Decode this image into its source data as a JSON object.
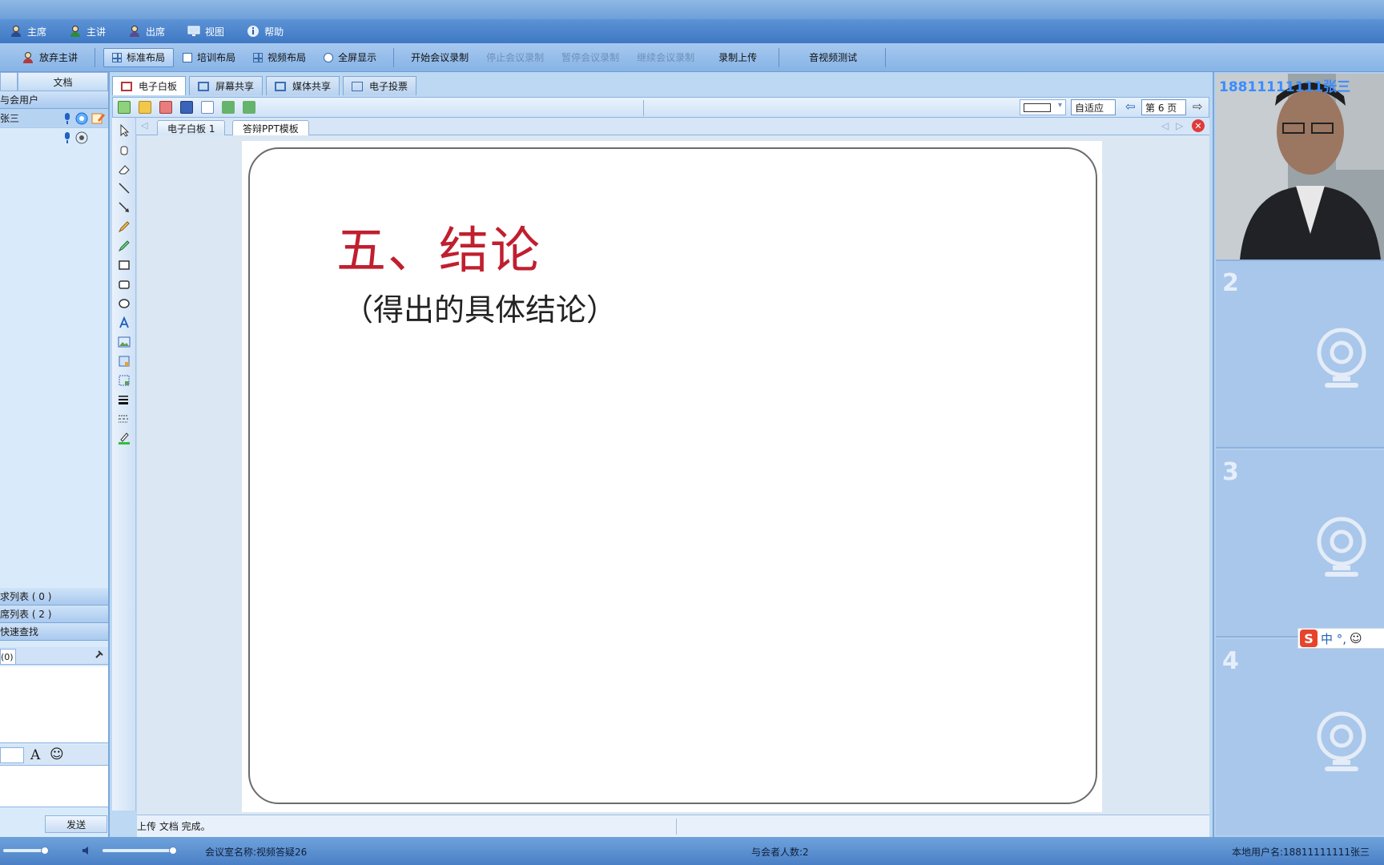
{
  "menubar": {
    "items": [
      {
        "label": "主席"
      },
      {
        "label": "主讲"
      },
      {
        "label": "出席"
      },
      {
        "label": "视图"
      },
      {
        "label": "帮助"
      }
    ]
  },
  "toolbar": {
    "give_up": "放弃主讲",
    "standard_layout": "标准布局",
    "training_layout": "培训布局",
    "video_layout": "视频布局",
    "fullscreen": "全屏显示",
    "start_record": "开始会议录制",
    "stop_record": "停止会议录制",
    "pause_record": "暂停会议录制",
    "resume_record": "继续会议录制",
    "upload_record": "录制上传",
    "av_test": "音视频测试"
  },
  "left_panel": {
    "tab_docs": "文档",
    "attendees_header": "与会用户",
    "user_name": "张三",
    "request_list": "求列表 ( 0 )",
    "attend_list": "席列表 ( 2 )",
    "quick_find": "快速查找",
    "chat_tab": "(0)",
    "send_button": "发送"
  },
  "center_tabs": [
    {
      "label": "电子白板"
    },
    {
      "label": "屏幕共享"
    },
    {
      "label": "媒体共享"
    },
    {
      "label": "电子投票"
    }
  ],
  "whiteboard": {
    "zoom_value": "自适应",
    "page_value": "第 6 页",
    "subtabs": [
      {
        "label": "电子白板 1"
      },
      {
        "label": "答辩PPT模板"
      }
    ],
    "slide_title": "五、结论",
    "slide_subtitle": "（得出的具体结论）",
    "status_message": "上传 文档 完成。"
  },
  "video": {
    "slot1_label": "18811111111张三",
    "slot2_num": "2",
    "slot3_num": "3",
    "slot4_num": "4",
    "ime": "中 °,"
  },
  "bottombar": {
    "room_name": "会议室名称:视频答疑26",
    "attendee_count": "与会者人数:2",
    "local_user": "本地用户名:18811111111张三"
  },
  "colors": {
    "accent": "#3f78c4",
    "title_red": "#c01f2f"
  }
}
